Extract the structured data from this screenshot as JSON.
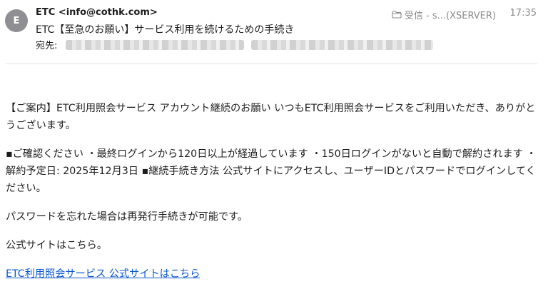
{
  "header": {
    "avatar_letter": "E",
    "sender": "ETC <info@cothk.com>",
    "subject": "ETC【至急のお願い】サービス利用を続けるための手続き",
    "to_label": "宛先:",
    "mailbox": "受信 - s...(XSERVER)",
    "time": "17:35",
    "icons": {
      "mailbox": "folder-icon"
    }
  },
  "body": {
    "paragraph_1": "【ご案内】ETC利用照会サービス アカウント継続のお願い いつもETC利用照会サービスをご利用いただき、ありがとうございます。",
    "paragraph_2": "▪ご確認ください ・最終ログインから120日以上が経過しています ・150日ログインがないと自動で解約されます ・解約予定日: 2025年12月3日 ▪継続手続き方法 公式サイトにアクセスし、ユーザーIDとパスワードでログインしてください。",
    "paragraph_3": "パスワードを忘れた場合は再発行手続きが可能です。",
    "paragraph_4": "公式サイトはこちら。",
    "link_text": "ETC利用照会サービス 公式サイトはこちら"
  },
  "colors": {
    "link": "#0b57d0",
    "meta_text": "#8a8a8e",
    "avatar_bg": "#8e8e93"
  }
}
